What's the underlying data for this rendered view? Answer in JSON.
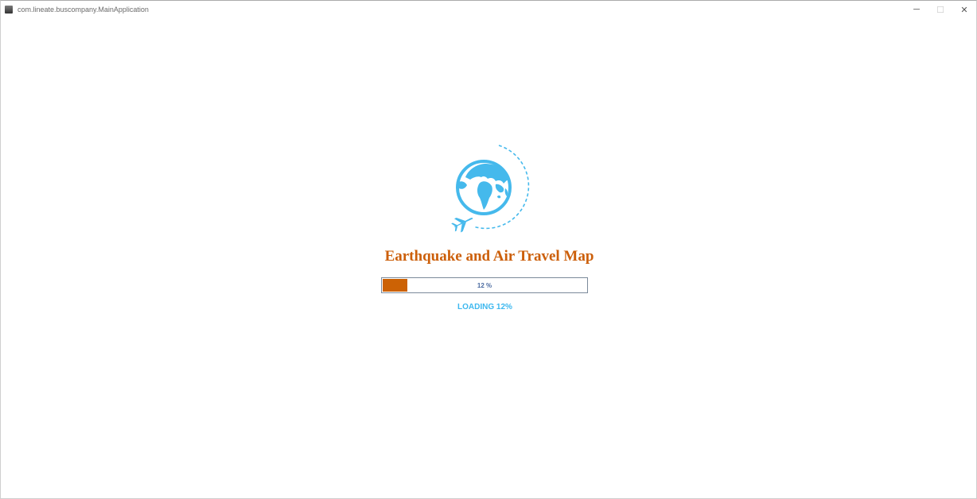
{
  "window": {
    "title": "com.lineate.buscompany.MainApplication",
    "controls": {
      "minimize": "─",
      "maximize": "☐",
      "close": "✕"
    }
  },
  "splash": {
    "logo_icon": "globe-airplane-icon",
    "title": "Earthquake and Air Travel Map",
    "progress": {
      "percent": 12,
      "label": "12 %"
    },
    "status": "LOADING 12%"
  },
  "colors": {
    "accent_orange": "#cc5f0a",
    "globe_blue": "#45b9ec",
    "loading_text": "#3db8ef",
    "progress_text": "#4a6aa0"
  }
}
